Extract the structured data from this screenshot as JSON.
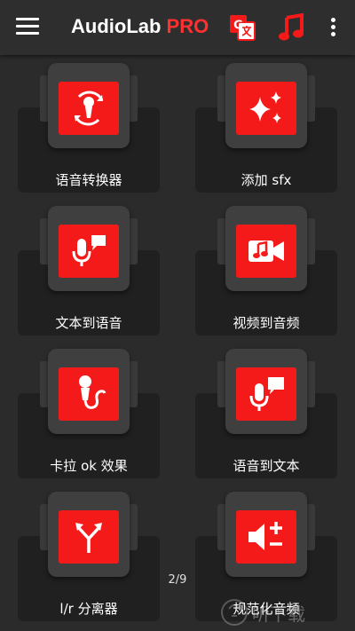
{
  "header": {
    "title_part1": "AudioLab",
    "title_part2": " PRO",
    "menu_icon": "hamburger-menu-icon",
    "translate_icon": "translate-icon",
    "music_icon": "music-note-icon",
    "more_icon": "more-vert-icon",
    "translate_icon_glyph": "G"
  },
  "colors": {
    "accent": "#f51a1a",
    "title_pro": "#ff3030",
    "background": "#2b2b2b",
    "appbar": "#2e2e2e"
  },
  "tiles": [
    {
      "label": "语音转换器",
      "icon": "voice-changer-icon"
    },
    {
      "label": "添加 sfx",
      "icon": "sparkle-icon"
    },
    {
      "label": "文本到语音",
      "icon": "mic-speech-icon"
    },
    {
      "label": "视频到音频",
      "icon": "video-music-icon"
    },
    {
      "label": "卡拉 ok 效果",
      "icon": "karaoke-mic-icon"
    },
    {
      "label": "语音到文本",
      "icon": "mic-speech-text-icon"
    },
    {
      "label": "l/r 分离器",
      "icon": "split-arrows-icon"
    },
    {
      "label": "规范化音频",
      "icon": "volume-normalize-icon"
    }
  ],
  "pagination": {
    "text": "2/9"
  },
  "watermark": {
    "text": "听下载"
  }
}
